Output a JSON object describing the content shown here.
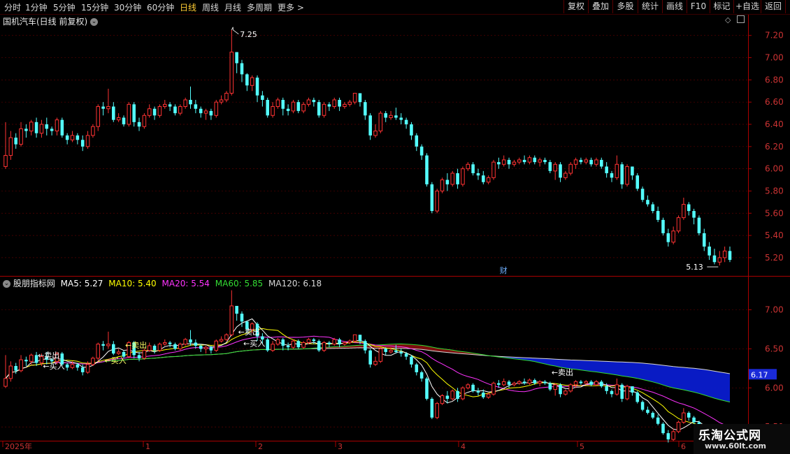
{
  "toolbar": {
    "periods": [
      "分时",
      "1分钟",
      "5分钟",
      "15分钟",
      "30分钟",
      "60分钟",
      "日线",
      "周线",
      "月线",
      "多周期",
      "更多 >"
    ],
    "active_period": "日线",
    "buttons": [
      "复权",
      "叠加",
      "多股",
      "统计",
      "画线",
      "F10",
      "+自选",
      "返回"
    ],
    "partial_button": "标记"
  },
  "main_panel": {
    "title": "国机汽车(日线 前复权)",
    "high_label": "7.25",
    "low_label": "5.13",
    "finance_marker": "财",
    "price_ticks": [
      "7.20",
      "7.00",
      "6.80",
      "6.60",
      "6.40",
      "6.20",
      "6.00",
      "5.80",
      "5.60",
      "5.40",
      "5.20"
    ]
  },
  "indicator_panel": {
    "name": "股朋指标网",
    "ma": [
      {
        "label": "MA5: 5.27",
        "color": "#ffffff"
      },
      {
        "label": "MA10: 5.40",
        "color": "#ffff00"
      },
      {
        "label": "MA20: 5.54",
        "color": "#ff33ff"
      },
      {
        "label": "MA60: 5.85",
        "color": "#33dd33"
      },
      {
        "label": "MA120: 6.18",
        "color": "#d8d8d8"
      }
    ],
    "price_ticks": [
      "7.00",
      "6.50",
      "6.00",
      "5.50"
    ],
    "current_value": "6.17",
    "signals": [
      {
        "text": "←卖出",
        "color": "#ffffff"
      },
      {
        "text": "←买入",
        "color": "#ffffff"
      },
      {
        "text": "←卖出",
        "color": "#ffff66"
      },
      {
        "text": "←买入",
        "color": "#ffff66"
      },
      {
        "text": "←卖出",
        "color": "#ffffff"
      },
      {
        "text": "←买入",
        "color": "#ffffff"
      },
      {
        "text": "←卖出",
        "color": "#ffffff"
      }
    ]
  },
  "time_axis": {
    "labels": [
      "2025年",
      "1",
      "2",
      "3",
      "4",
      "5",
      "6"
    ]
  },
  "watermark": {
    "title": "乐淘公式网",
    "url": "www.60lt.com"
  },
  "colors": {
    "up": "#ff3333",
    "down": "#54ffff",
    "grid": "#5a0000",
    "axis": "#aa0000",
    "accent": "#ffcc33"
  },
  "chart_data": {
    "type": "candlestick",
    "y_range_main": [
      5.08,
      7.28
    ],
    "y_range_indicator": [
      5.35,
      7.3
    ],
    "candles": [
      [
        6.02,
        6.12,
        6.0,
        6.42
      ],
      [
        6.12,
        6.28,
        6.08,
        6.34
      ],
      [
        6.28,
        6.22,
        6.18,
        6.32
      ],
      [
        6.22,
        6.36,
        6.2,
        6.42
      ],
      [
        6.36,
        6.34,
        6.28,
        6.4
      ],
      [
        6.34,
        6.42,
        6.3,
        6.44
      ],
      [
        6.42,
        6.32,
        6.28,
        6.46
      ],
      [
        6.32,
        6.4,
        6.28,
        6.44
      ],
      [
        6.4,
        6.36,
        6.3,
        6.46
      ],
      [
        6.36,
        6.34,
        6.3,
        6.38
      ],
      [
        6.34,
        6.44,
        6.3,
        6.46
      ],
      [
        6.44,
        6.3,
        6.28,
        6.46
      ],
      [
        6.3,
        6.26,
        6.22,
        6.32
      ],
      [
        6.26,
        6.3,
        6.24,
        6.34
      ],
      [
        6.3,
        6.26,
        6.22,
        6.32
      ],
      [
        6.26,
        6.2,
        6.16,
        6.3
      ],
      [
        6.2,
        6.3,
        6.18,
        6.34
      ],
      [
        6.3,
        6.38,
        6.28,
        6.4
      ],
      [
        6.38,
        6.56,
        6.34,
        6.58
      ],
      [
        6.56,
        6.54,
        6.48,
        6.6
      ],
      [
        6.54,
        6.56,
        6.5,
        6.72
      ],
      [
        6.56,
        6.44,
        6.42,
        6.6
      ],
      [
        6.44,
        6.46,
        6.42,
        6.5
      ],
      [
        6.46,
        6.4,
        6.38,
        6.48
      ],
      [
        6.4,
        6.58,
        6.38,
        6.6
      ],
      [
        6.58,
        6.42,
        6.38,
        6.6
      ],
      [
        6.42,
        6.38,
        6.34,
        6.46
      ],
      [
        6.38,
        6.48,
        6.36,
        6.5
      ],
      [
        6.48,
        6.54,
        6.46,
        6.58
      ],
      [
        6.54,
        6.48,
        6.44,
        6.56
      ],
      [
        6.48,
        6.56,
        6.46,
        6.58
      ],
      [
        6.56,
        6.58,
        6.54,
        6.62
      ],
      [
        6.58,
        6.56,
        6.52,
        6.6
      ],
      [
        6.56,
        6.5,
        6.48,
        6.58
      ],
      [
        6.5,
        6.56,
        6.48,
        6.58
      ],
      [
        6.56,
        6.62,
        6.54,
        6.64
      ],
      [
        6.62,
        6.58,
        6.54,
        6.74
      ],
      [
        6.58,
        6.54,
        6.5,
        6.62
      ],
      [
        6.54,
        6.5,
        6.46,
        6.56
      ],
      [
        6.5,
        6.52,
        6.44,
        6.54
      ],
      [
        6.52,
        6.48,
        6.44,
        6.54
      ],
      [
        6.48,
        6.6,
        6.46,
        6.62
      ],
      [
        6.6,
        6.62,
        6.58,
        6.66
      ],
      [
        6.62,
        6.68,
        6.6,
        6.7
      ],
      [
        6.68,
        7.05,
        6.66,
        7.25
      ],
      [
        7.05,
        6.95,
        6.86,
        7.02
      ],
      [
        6.95,
        6.85,
        6.78,
        6.98
      ],
      [
        6.85,
        6.75,
        6.7,
        6.86
      ],
      [
        6.75,
        6.82,
        6.7,
        6.84
      ],
      [
        6.82,
        6.66,
        6.6,
        6.84
      ],
      [
        6.66,
        6.62,
        6.56,
        6.7
      ],
      [
        6.62,
        6.48,
        6.46,
        6.64
      ],
      [
        6.48,
        6.56,
        6.46,
        6.6
      ],
      [
        6.56,
        6.62,
        6.54,
        6.64
      ],
      [
        6.62,
        6.54,
        6.48,
        6.64
      ],
      [
        6.54,
        6.52,
        6.48,
        6.58
      ],
      [
        6.52,
        6.6,
        6.5,
        6.62
      ],
      [
        6.6,
        6.52,
        6.5,
        6.62
      ],
      [
        6.52,
        6.58,
        6.5,
        6.6
      ],
      [
        6.58,
        6.62,
        6.56,
        6.64
      ],
      [
        6.62,
        6.6,
        6.56,
        6.64
      ],
      [
        6.6,
        6.48,
        6.46,
        6.62
      ],
      [
        6.48,
        6.58,
        6.46,
        6.6
      ],
      [
        6.58,
        6.56,
        6.52,
        6.6
      ],
      [
        6.56,
        6.62,
        6.54,
        6.64
      ],
      [
        6.62,
        6.56,
        6.52,
        6.64
      ],
      [
        6.56,
        6.58,
        6.54,
        6.6
      ],
      [
        6.58,
        6.6,
        6.56,
        6.62
      ],
      [
        6.6,
        6.68,
        6.58,
        6.68
      ],
      [
        6.68,
        6.6,
        6.56,
        6.68
      ],
      [
        6.6,
        6.48,
        6.44,
        6.62
      ],
      [
        6.48,
        6.3,
        6.26,
        6.5
      ],
      [
        6.3,
        6.34,
        6.28,
        6.4
      ],
      [
        6.34,
        6.5,
        6.32,
        6.52
      ],
      [
        6.5,
        6.46,
        6.42,
        6.52
      ],
      [
        6.46,
        6.48,
        6.44,
        6.52
      ],
      [
        6.48,
        6.46,
        6.44,
        6.55
      ],
      [
        6.46,
        6.44,
        6.4,
        6.5
      ],
      [
        6.44,
        6.4,
        6.36,
        6.46
      ],
      [
        6.4,
        6.3,
        6.26,
        6.42
      ],
      [
        6.3,
        6.2,
        6.16,
        6.32
      ],
      [
        6.2,
        6.12,
        6.08,
        6.22
      ],
      [
        6.12,
        5.86,
        5.84,
        6.14
      ],
      [
        5.86,
        5.62,
        5.6,
        5.88
      ],
      [
        5.62,
        5.8,
        5.6,
        5.82
      ],
      [
        5.8,
        5.9,
        5.78,
        5.92
      ],
      [
        5.9,
        5.86,
        5.8,
        5.96
      ],
      [
        5.86,
        5.96,
        5.84,
        5.98
      ],
      [
        5.96,
        5.86,
        5.82,
        6.0
      ],
      [
        5.86,
        6.0,
        5.84,
        6.02
      ],
      [
        6.0,
        6.04,
        5.98,
        6.06
      ],
      [
        6.04,
        5.96,
        5.94,
        6.06
      ],
      [
        5.96,
        5.94,
        5.9,
        6.0
      ],
      [
        5.94,
        5.88,
        5.86,
        5.98
      ],
      [
        5.88,
        5.92,
        5.86,
        5.94
      ],
      [
        5.92,
        6.06,
        5.9,
        6.08
      ],
      [
        6.06,
        6.04,
        6.0,
        6.1
      ],
      [
        6.04,
        6.08,
        6.02,
        6.12
      ],
      [
        6.08,
        6.04,
        6.0,
        6.1
      ],
      [
        6.04,
        6.06,
        6.02,
        6.08
      ],
      [
        6.06,
        6.08,
        6.04,
        6.1
      ],
      [
        6.08,
        6.06,
        6.04,
        6.12
      ],
      [
        6.06,
        6.1,
        6.04,
        6.12
      ],
      [
        6.1,
        6.06,
        6.04,
        6.12
      ],
      [
        6.06,
        6.08,
        6.02,
        6.1
      ],
      [
        6.08,
        6.06,
        6.04,
        6.1
      ],
      [
        6.06,
        5.98,
        5.96,
        6.08
      ],
      [
        5.98,
        6.04,
        5.9,
        6.06
      ],
      [
        6.04,
        5.92,
        5.88,
        6.06
      ],
      [
        5.92,
        5.96,
        5.9,
        5.98
      ],
      [
        5.96,
        6.04,
        5.94,
        6.06
      ],
      [
        6.04,
        6.08,
        6.0,
        6.1
      ],
      [
        6.08,
        6.06,
        6.04,
        6.1
      ],
      [
        6.06,
        6.08,
        6.04,
        6.1
      ],
      [
        6.08,
        6.04,
        6.02,
        6.1
      ],
      [
        6.04,
        6.08,
        6.02,
        6.1
      ],
      [
        6.08,
        6.02,
        6.0,
        6.1
      ],
      [
        6.02,
        5.96,
        5.92,
        6.06
      ],
      [
        5.96,
        5.92,
        5.88,
        5.98
      ],
      [
        5.92,
        6.04,
        5.9,
        6.12
      ],
      [
        6.04,
        5.86,
        5.82,
        6.06
      ],
      [
        5.86,
        6.02,
        5.84,
        6.04
      ],
      [
        6.02,
        5.94,
        5.9,
        6.02
      ],
      [
        5.94,
        5.82,
        5.8,
        5.96
      ],
      [
        5.82,
        5.72,
        5.7,
        5.84
      ],
      [
        5.72,
        5.68,
        5.66,
        5.76
      ],
      [
        5.68,
        5.62,
        5.6,
        5.7
      ],
      [
        5.62,
        5.54,
        5.52,
        5.66
      ],
      [
        5.54,
        5.42,
        5.4,
        5.56
      ],
      [
        5.42,
        5.34,
        5.3,
        5.46
      ],
      [
        5.34,
        5.44,
        5.32,
        5.48
      ],
      [
        5.44,
        5.56,
        5.42,
        5.58
      ],
      [
        5.56,
        5.68,
        5.54,
        5.74
      ],
      [
        5.68,
        5.62,
        5.58,
        5.7
      ],
      [
        5.62,
        5.56,
        5.5,
        5.64
      ],
      [
        5.56,
        5.42,
        5.4,
        5.58
      ],
      [
        5.42,
        5.3,
        5.26,
        5.46
      ],
      [
        5.3,
        5.22,
        5.18,
        5.34
      ],
      [
        5.22,
        5.16,
        5.14,
        5.28
      ],
      [
        5.16,
        5.2,
        5.13,
        5.26
      ],
      [
        5.2,
        5.26,
        5.16,
        5.3
      ],
      [
        5.26,
        5.18,
        5.16,
        5.3
      ]
    ]
  }
}
